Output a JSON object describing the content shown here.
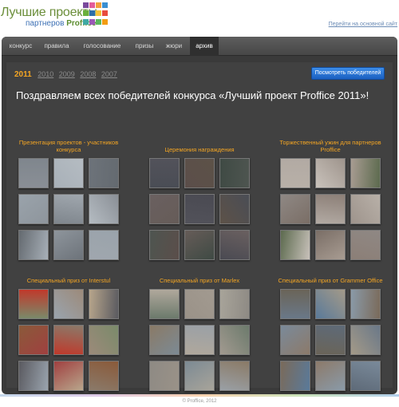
{
  "header": {
    "logo_line1": "Лучшие проекты",
    "logo_line2_prefix": "партнеров ",
    "logo_brand": "Proffice",
    "main_site_link": "Перейти на основной сайт",
    "logo_square_colors": [
      "#7a4a9c",
      "#e35d9a",
      "#f2a03d",
      "#3a8fd1",
      "#6bb03c",
      "#2d6ea8",
      "#f4c33a",
      "#e84c3d",
      "#3fa9a4",
      "#9b59b6",
      "#5cb85c",
      "#f39c12"
    ]
  },
  "nav": {
    "items": [
      {
        "label": "конкурс"
      },
      {
        "label": "правила"
      },
      {
        "label": "голосование"
      },
      {
        "label": "призы"
      },
      {
        "label": "жюри"
      },
      {
        "label": "архив",
        "active": true
      }
    ]
  },
  "archive": {
    "years": [
      "2011",
      "2010",
      "2009",
      "2008",
      "2007"
    ],
    "current_year": "2011",
    "winners_button": "Посмотреть победителей",
    "headline": "Поздравляем всех победителей конкурса «Лучший проект Proffice 2011»!"
  },
  "groups": [
    {
      "title": "Презентация проектов - участников конкурса"
    },
    {
      "title": "Церемония награждения"
    },
    {
      "title": "Торжественный ужин для партнеров Proffice"
    },
    {
      "title": "Специальный приз от Interstul"
    },
    {
      "title": "Специальный приз от Marlex"
    },
    {
      "title": "Специальный приз от Grammer Office"
    }
  ],
  "footer": {
    "copyright": "© Proffice, 2012"
  }
}
